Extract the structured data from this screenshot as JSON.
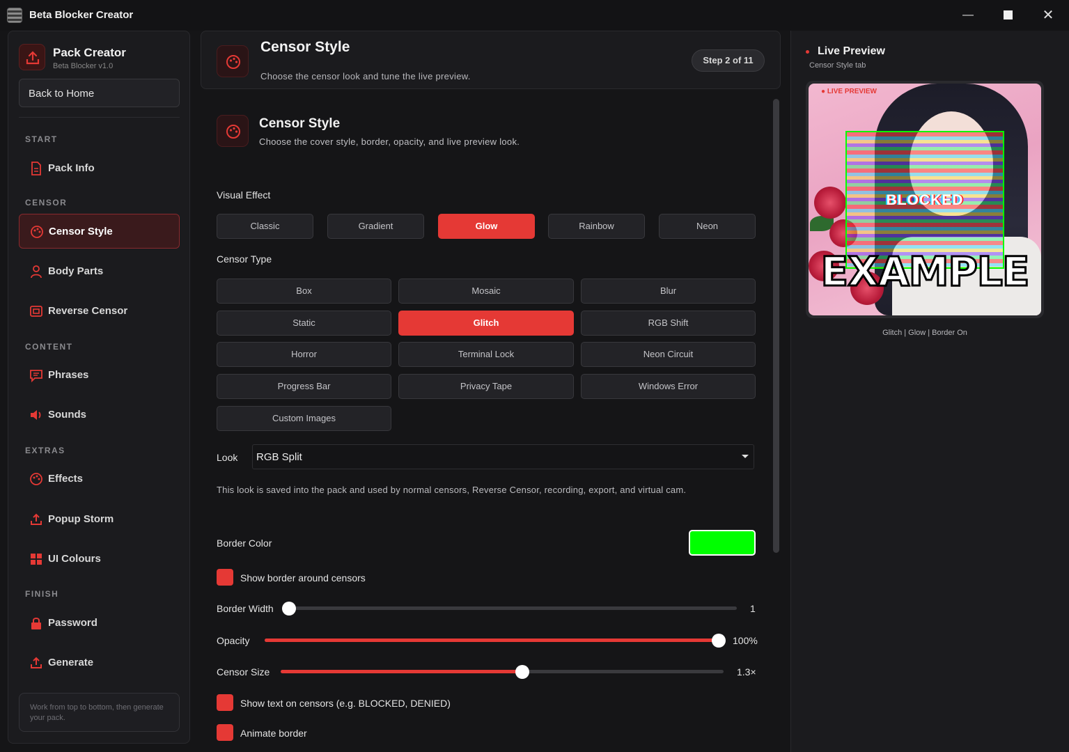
{
  "window": {
    "title": "Beta Blocker Creator",
    "min": "—",
    "close": "✕"
  },
  "sidebar": {
    "brand_title": "Pack Creator",
    "brand_sub": "Beta Blocker v1.0",
    "back_label": "Back to Home",
    "sections": {
      "start": "START",
      "censor": "CENSOR",
      "content": "CONTENT",
      "extras": "EXTRAS",
      "finish": "FINISH"
    },
    "items": {
      "pack_info": "Pack Info",
      "censor_style": "Censor Style",
      "body_parts": "Body Parts",
      "reverse_censor": "Reverse Censor",
      "phrases": "Phrases",
      "sounds": "Sounds",
      "effects": "Effects",
      "popup_storm": "Popup Storm",
      "ui_colours": "UI Colours",
      "password": "Password",
      "generate": "Generate"
    },
    "tip": "Work from top to bottom, then generate your pack."
  },
  "header": {
    "title": "Censor Style",
    "subtitle": "Choose the censor look and tune the live preview.",
    "step": "Step 2 of 11"
  },
  "section": {
    "title": "Censor Style",
    "subtitle": "Choose the cover style, border, opacity, and live preview look."
  },
  "visual_effect": {
    "label": "Visual Effect",
    "options": [
      "Classic",
      "Gradient",
      "Glow",
      "Rainbow",
      "Neon"
    ],
    "selected": "Glow"
  },
  "censor_type": {
    "label": "Censor Type",
    "options": [
      "Box",
      "Mosaic",
      "Blur",
      "Static",
      "Glitch",
      "RGB Shift",
      "Horror",
      "Terminal Lock",
      "Neon Circuit",
      "Progress Bar",
      "Privacy Tape",
      "Windows Error",
      "Custom Images"
    ],
    "selected": "Glitch"
  },
  "look": {
    "label": "Look",
    "value": "RGB Split",
    "note": "This look is saved into the pack and used by normal censors, Reverse Censor, recording, export, and virtual cam."
  },
  "border_color": {
    "label": "Border Color",
    "value": "#00ff00"
  },
  "show_border": {
    "label": "Show border around censors",
    "checked": true
  },
  "border_width": {
    "label": "Border Width",
    "value": "1",
    "fraction": 0.0
  },
  "opacity": {
    "label": "Opacity",
    "value": "100%",
    "fraction": 1.0
  },
  "censor_size": {
    "label": "Censor Size",
    "value": "1.3×",
    "fraction": 0.545
  },
  "show_text": {
    "label": "Show text on censors (e.g. BLOCKED, DENIED)",
    "checked": true
  },
  "animate_border": {
    "label": "Animate border",
    "checked": true
  },
  "preview": {
    "title": "Live Preview",
    "subtitle": "Censor Style tab",
    "live_badge": "● LIVE PREVIEW",
    "censor_text": "BLOCKED",
    "watermark": "EXAMPLE",
    "caption": "Glitch | Glow | Border On"
  },
  "colors": {
    "accent": "#e53935",
    "background": "#151517",
    "panel": "#1b1b1e"
  }
}
